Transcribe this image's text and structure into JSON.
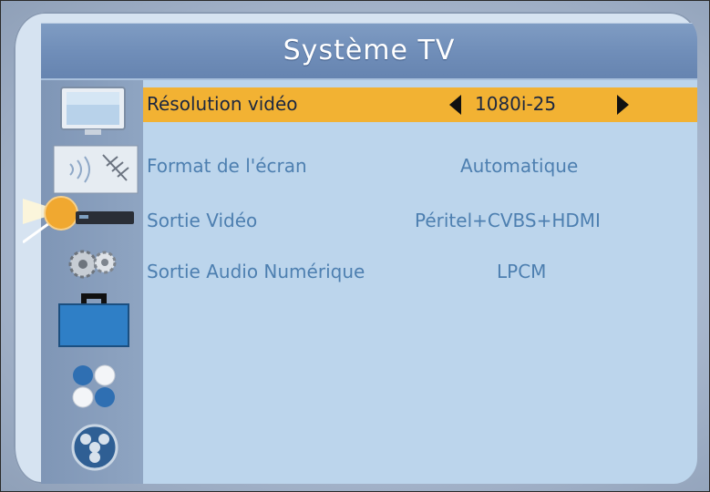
{
  "header": {
    "title": "Système TV"
  },
  "menu": {
    "rows": [
      {
        "label": "Résolution vidéo",
        "value": "1080i-25",
        "selected": true
      },
      {
        "label": "Format de l'écran",
        "value": "Automatique",
        "selected": false
      },
      {
        "label": "Sortie Vidéo",
        "value": "Péritel+CVBS+HDMI",
        "selected": false
      },
      {
        "label": "Sortie Audio Numérique",
        "value": "LPCM",
        "selected": false
      }
    ]
  },
  "sidebar": {
    "icons": [
      "tv-icon",
      "antenna-icon",
      "receiver-icon",
      "gears-icon",
      "toolbox-icon",
      "spheres-icon",
      "film-reel-icon"
    ]
  },
  "colors": {
    "highlight": "#f2b233",
    "text": "#4d7fb0",
    "title_bar": "#6f8db8",
    "content_bg": "#bcd5ec"
  }
}
